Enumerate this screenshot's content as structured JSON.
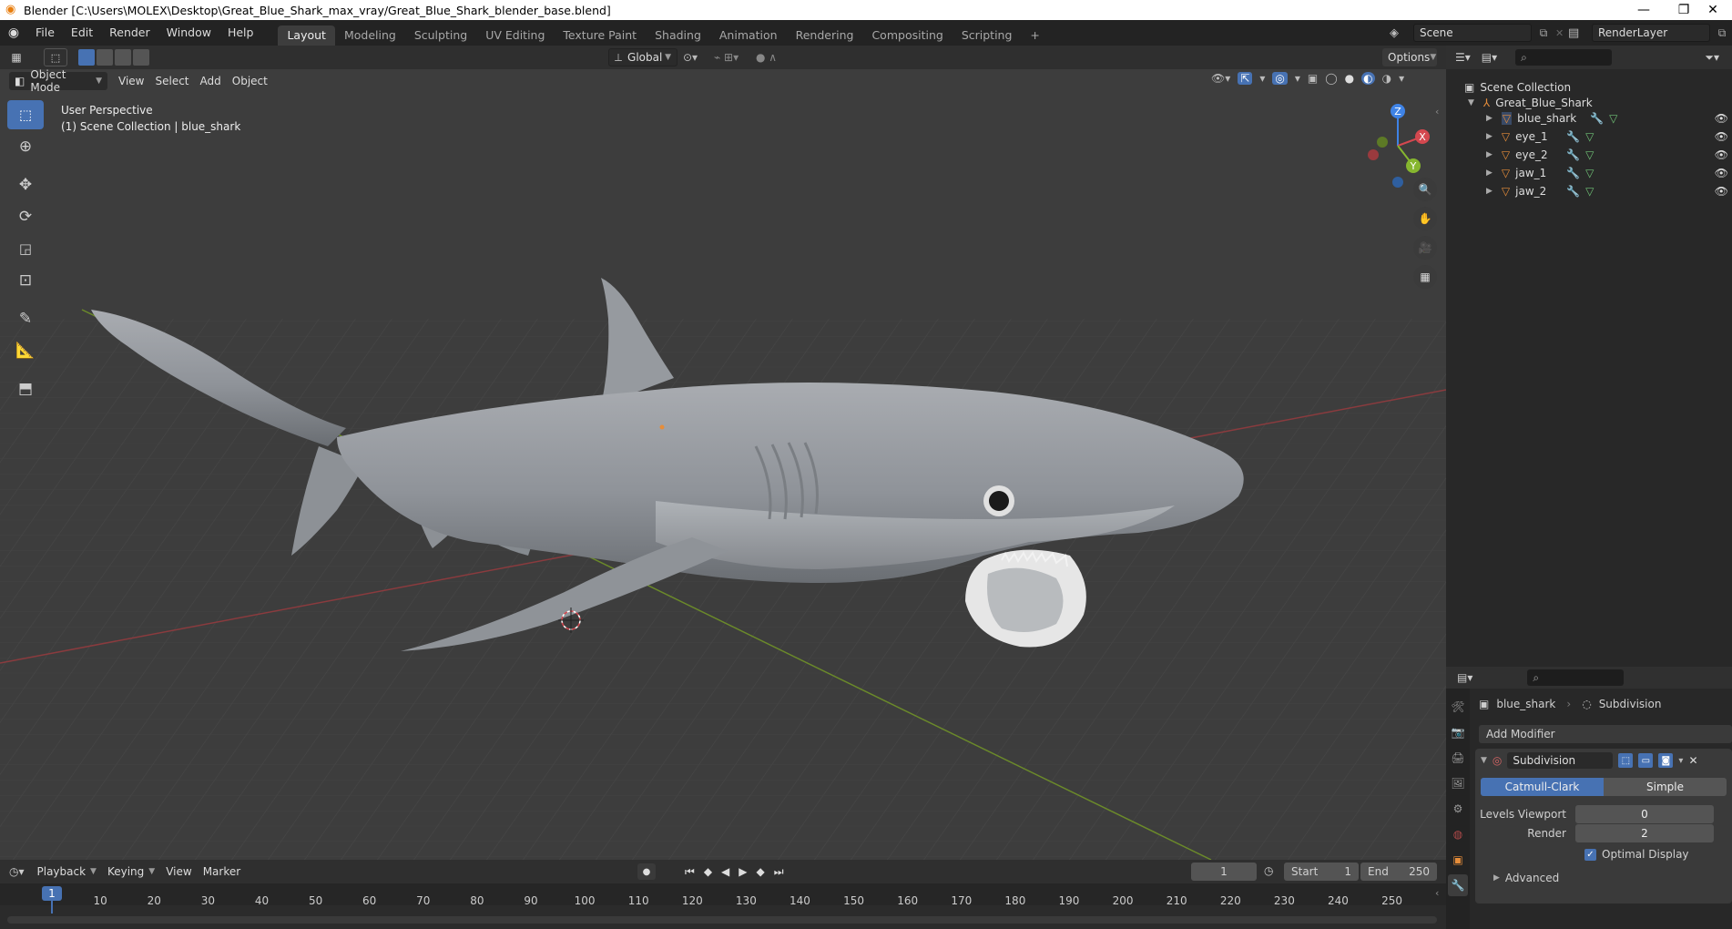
{
  "window": {
    "title": "Blender [C:\\Users\\MOLEX\\Desktop\\Great_Blue_Shark_max_vray/Great_Blue_Shark_blender_base.blend]",
    "minimize": "—",
    "maximize": "❐",
    "close": "✕"
  },
  "menu": [
    "File",
    "Edit",
    "Render",
    "Window",
    "Help"
  ],
  "workspaces": [
    "Layout",
    "Modeling",
    "Sculpting",
    "UV Editing",
    "Texture Paint",
    "Shading",
    "Animation",
    "Rendering",
    "Compositing",
    "Scripting"
  ],
  "workspace_add": "+",
  "scene": {
    "name": "Scene",
    "render_layer": "RenderLayer"
  },
  "viewport_header": {
    "orientation": "Global",
    "options": "Options",
    "mode": "Object Mode",
    "menus": [
      "View",
      "Select",
      "Add",
      "Object"
    ]
  },
  "viewport": {
    "perspective": "User Perspective",
    "collection_label": "(1) Scene Collection | blue_shark",
    "gizmo": {
      "x": "X",
      "y": "Y",
      "z": "Z"
    }
  },
  "outliner": {
    "root": "Scene Collection",
    "collection": "Great_Blue_Shark",
    "objects": [
      "blue_shark",
      "eye_1",
      "eye_2",
      "jaw_1",
      "jaw_2"
    ]
  },
  "properties": {
    "object": "blue_shark",
    "modifier_crumb": "Subdivision",
    "add_modifier": "Add Modifier",
    "modifier_name": "Subdivision",
    "tabs": [
      "Catmull-Clark",
      "Simple"
    ],
    "levels_viewport_label": "Levels Viewport",
    "levels_viewport": "0",
    "render_label": "Render",
    "render": "2",
    "optimal_display": "Optimal Display",
    "optimal_display_checked": true,
    "advanced": "Advanced"
  },
  "timeline": {
    "menus": [
      "Playback",
      "Keying",
      "View",
      "Marker"
    ],
    "current_frame": "1",
    "start_label": "Start",
    "start": "1",
    "end_label": "End",
    "end": "250",
    "ticks": [
      "1",
      "10",
      "20",
      "30",
      "40",
      "50",
      "60",
      "70",
      "80",
      "90",
      "100",
      "110",
      "120",
      "130",
      "140",
      "150",
      "160",
      "170",
      "180",
      "190",
      "200",
      "210",
      "220",
      "230",
      "240",
      "250"
    ]
  },
  "colors": {
    "accent": "#4772b3",
    "x_axis": "#d4484f",
    "y_axis": "#86b62f",
    "z_axis": "#3f83e6",
    "viewport_bg": "#3d3d3d",
    "object_orange": "#e68d3a"
  }
}
